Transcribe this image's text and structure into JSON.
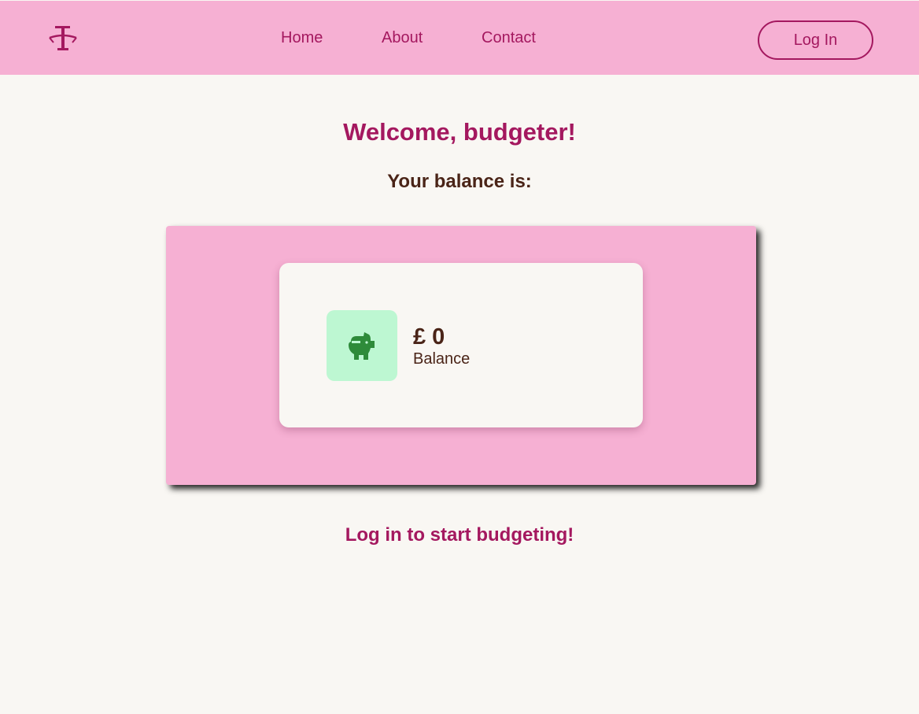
{
  "nav": {
    "links": [
      "Home",
      "About",
      "Contact"
    ],
    "login_label": "Log In"
  },
  "main": {
    "welcome": "Welcome, budgeter!",
    "balance_heading": "Your balance is:",
    "balance": {
      "amount": "£ 0",
      "label": "Balance",
      "icon": "piggy-bank-icon"
    },
    "cta": "Log in to start budgeting!"
  },
  "colors": {
    "accent": "#a4185f",
    "navbar_bg": "#f6b0d3",
    "page_bg": "#f9f7f3",
    "text_dark": "#4a2417",
    "icon_bg": "#bdf7d2",
    "icon_fg": "#2e8b3a"
  }
}
